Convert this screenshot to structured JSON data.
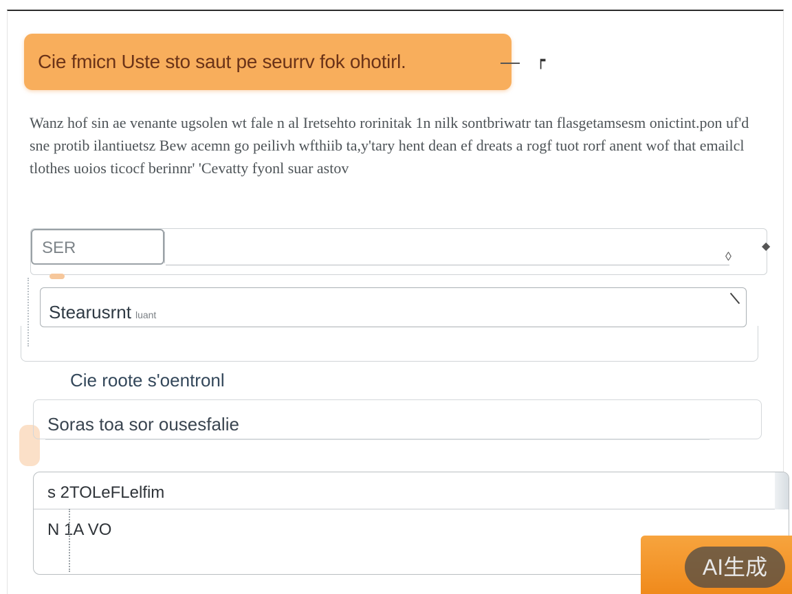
{
  "banner": {
    "text": "Cie  fmicn Uste  sto saut  pe seurrv fok ohotirl."
  },
  "icons": {
    "pin": "pin-icon",
    "chevron": "chevron-down-icon",
    "handle": "drag-handle-icon"
  },
  "description": "Wanz hof sin ae venante ugsolen wt fale  n al  Iretsehto rorinitak  1n nilk sontbriwatr tan flasgetamsesm onictint.pon uf'd sne protib ilantiuetsz Bew acemn go peilivh wfthiib ta,y'tary hent dean  ef  dreats a rogf  tuot  rorf anent wof  that emailcl tlothes uoios ticocf  berinnr' 'Cevatty fyonl suar astov",
  "select": {
    "prefix": "SER"
  },
  "search_input": {
    "value": "Stearusrnt",
    "hint": "luant"
  },
  "section": {
    "heading": "Cie roote s'oentronl",
    "option_value": "Soras toa  sor ousesfalie"
  },
  "list": {
    "items": [
      "s 2TOLeFLelfim",
      "N  1A  VO"
    ]
  },
  "generate_button": {
    "label": "AI生成"
  },
  "colors": {
    "accent": "#f8ae5c",
    "button": "#f08a1c"
  }
}
